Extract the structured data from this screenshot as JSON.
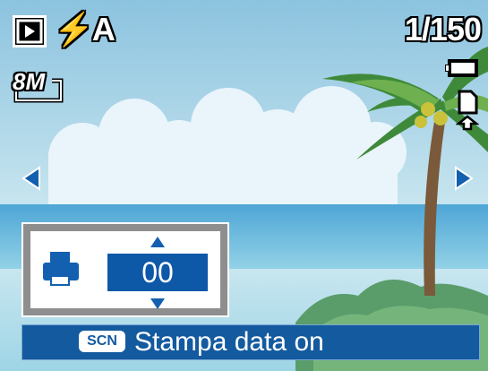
{
  "osd": {
    "flash_mode": "⚡A",
    "image_counter": "1/150",
    "resolution": "8M"
  },
  "print_setting": {
    "value": "00"
  },
  "status": {
    "badge": "SCN",
    "message": "Stampa data on"
  },
  "icons": {
    "playback": "play-mode-icon",
    "flash": "flash-auto-icon",
    "resolution": "resolution-8m-icon",
    "battery": "battery-full-icon",
    "memory": "memory-card-icon",
    "prev": "arrow-left-icon",
    "next": "arrow-right-icon",
    "printer": "printer-icon",
    "up": "arrow-up-icon",
    "down": "arrow-down-icon"
  },
  "colors": {
    "accent_blue": "#135a9f",
    "value_blue": "#0e58a8",
    "sky": "#a9d4e5",
    "sea": "#6fbadb"
  }
}
